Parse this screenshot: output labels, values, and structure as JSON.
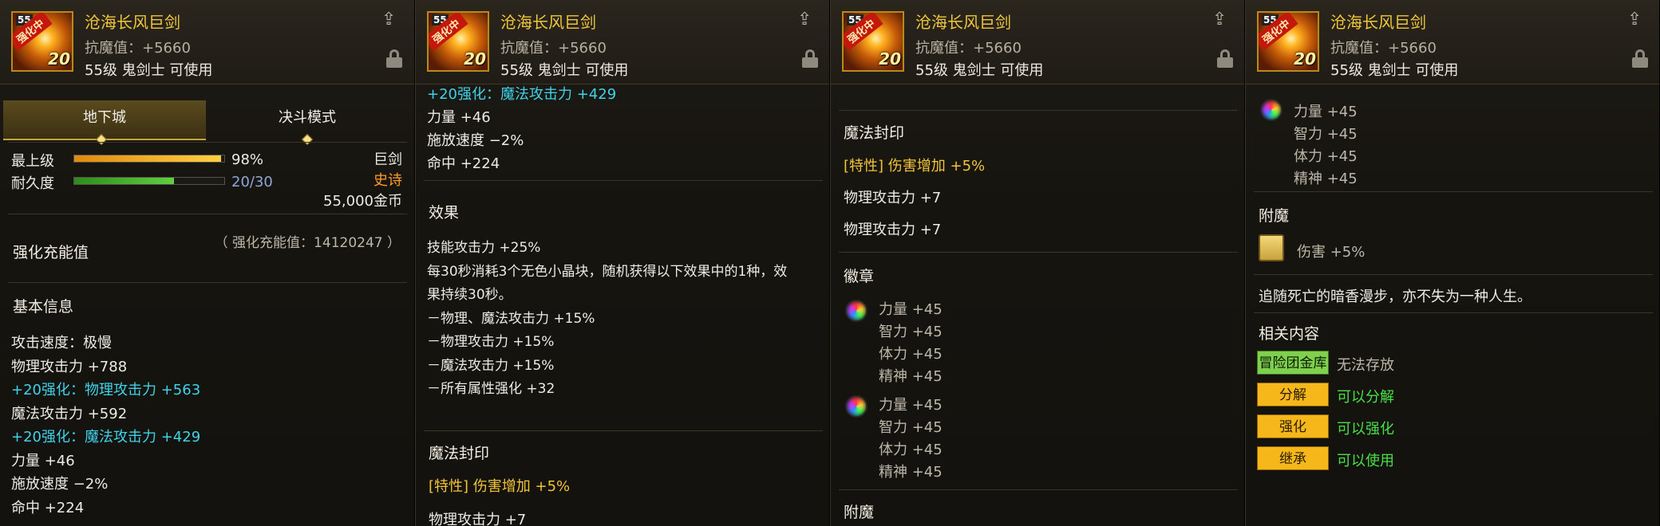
{
  "item": {
    "name": "沧海长风巨剑",
    "resist": "抗魔值：+5660",
    "requirement": "55级 鬼剑士 可使用",
    "badge_level": "55",
    "badge_tag": "强化中",
    "badge_plus": "20"
  },
  "panel1": {
    "tabs": [
      "地下城",
      "决斗模式"
    ],
    "grade_label": "最上级",
    "grade_value": "98%",
    "grade_fraction": 0.98,
    "durability_label": "耐久度",
    "durability_value": "20/30",
    "durability_fraction": 0.667,
    "type": "巨剑",
    "rarity": "史诗",
    "price": "55,000金币",
    "charge_label": "强化充能值",
    "charge_value": "（ 强化充能值：14120247 ）",
    "basic_header": "基本信息",
    "stats": [
      {
        "text": "攻击速度：极慢",
        "color": "white"
      },
      {
        "text": "物理攻击力 +788",
        "color": "white"
      },
      {
        "text": "+20强化：物理攻击力 +563",
        "color": "cyan"
      },
      {
        "text": "魔法攻击力 +592",
        "color": "white"
      },
      {
        "text": "+20强化：魔法攻击力 +429",
        "color": "cyan"
      },
      {
        "text": "力量 +46",
        "color": "white"
      },
      {
        "text": "施放速度 −2%",
        "color": "white"
      },
      {
        "text": "命中 +224",
        "color": "white"
      }
    ]
  },
  "panel2": {
    "top_lines": [
      {
        "text": "+20强化：魔法攻击力 +429",
        "color": "cyan"
      },
      {
        "text": "力量 +46",
        "color": "white"
      },
      {
        "text": "施放速度 −2%",
        "color": "white"
      },
      {
        "text": "命中 +224",
        "color": "white"
      }
    ],
    "effect_header": "效果",
    "effect_lines": [
      "技能攻击力 +25%",
      "每30秒消耗3个无色小晶块，随机获得以下效果中的1种，效",
      "果持续30秒。",
      "－物理、魔法攻击力 +15%",
      "－物理攻击力 +15%",
      "－魔法攻击力 +15%",
      "－所有属性强化 +32"
    ],
    "seal_header": "魔法封印",
    "seal_line": "[特性] 伤害增加 +5%",
    "cut_line": "物理攻击力 +7"
  },
  "panel3": {
    "seal_header": "魔法封印",
    "seal_line": "[特性] 伤害增加 +5%",
    "seal_stats": [
      "物理攻击力 +7",
      "物理攻击力 +7"
    ],
    "emblem_header": "徽章",
    "emblem1": [
      "力量 +45",
      "智力 +45",
      "体力 +45",
      "精神 +45"
    ],
    "emblem2": [
      "力量 +45",
      "智力 +45",
      "体力 +45",
      "精神 +45"
    ],
    "enchant_header": "附魔"
  },
  "panel4": {
    "emblem": [
      "力量 +45",
      "智力 +45",
      "体力 +45",
      "精神 +45"
    ],
    "enchant_header": "附魔",
    "enchant_line": "伤害 +5%",
    "flavor": "追随死亡的暗香漫步，亦不失为一种人生。",
    "related_header": "相关内容",
    "related": [
      {
        "button": "冒险团金库",
        "status": "无法存放",
        "button_color": "green",
        "status_color": "grey"
      },
      {
        "button": "分解",
        "status": "可以分解",
        "button_color": "gold",
        "status_color": "green"
      },
      {
        "button": "强化",
        "status": "可以强化",
        "button_color": "gold",
        "status_color": "green"
      },
      {
        "button": "继承",
        "status": "可以使用",
        "button_color": "gold",
        "status_color": "green"
      }
    ]
  },
  "icons": {
    "share": "share-icon",
    "lock": "lock-icon",
    "emblem": "rainbow-emblem-icon",
    "enchant_card": "enchant-card-icon"
  }
}
